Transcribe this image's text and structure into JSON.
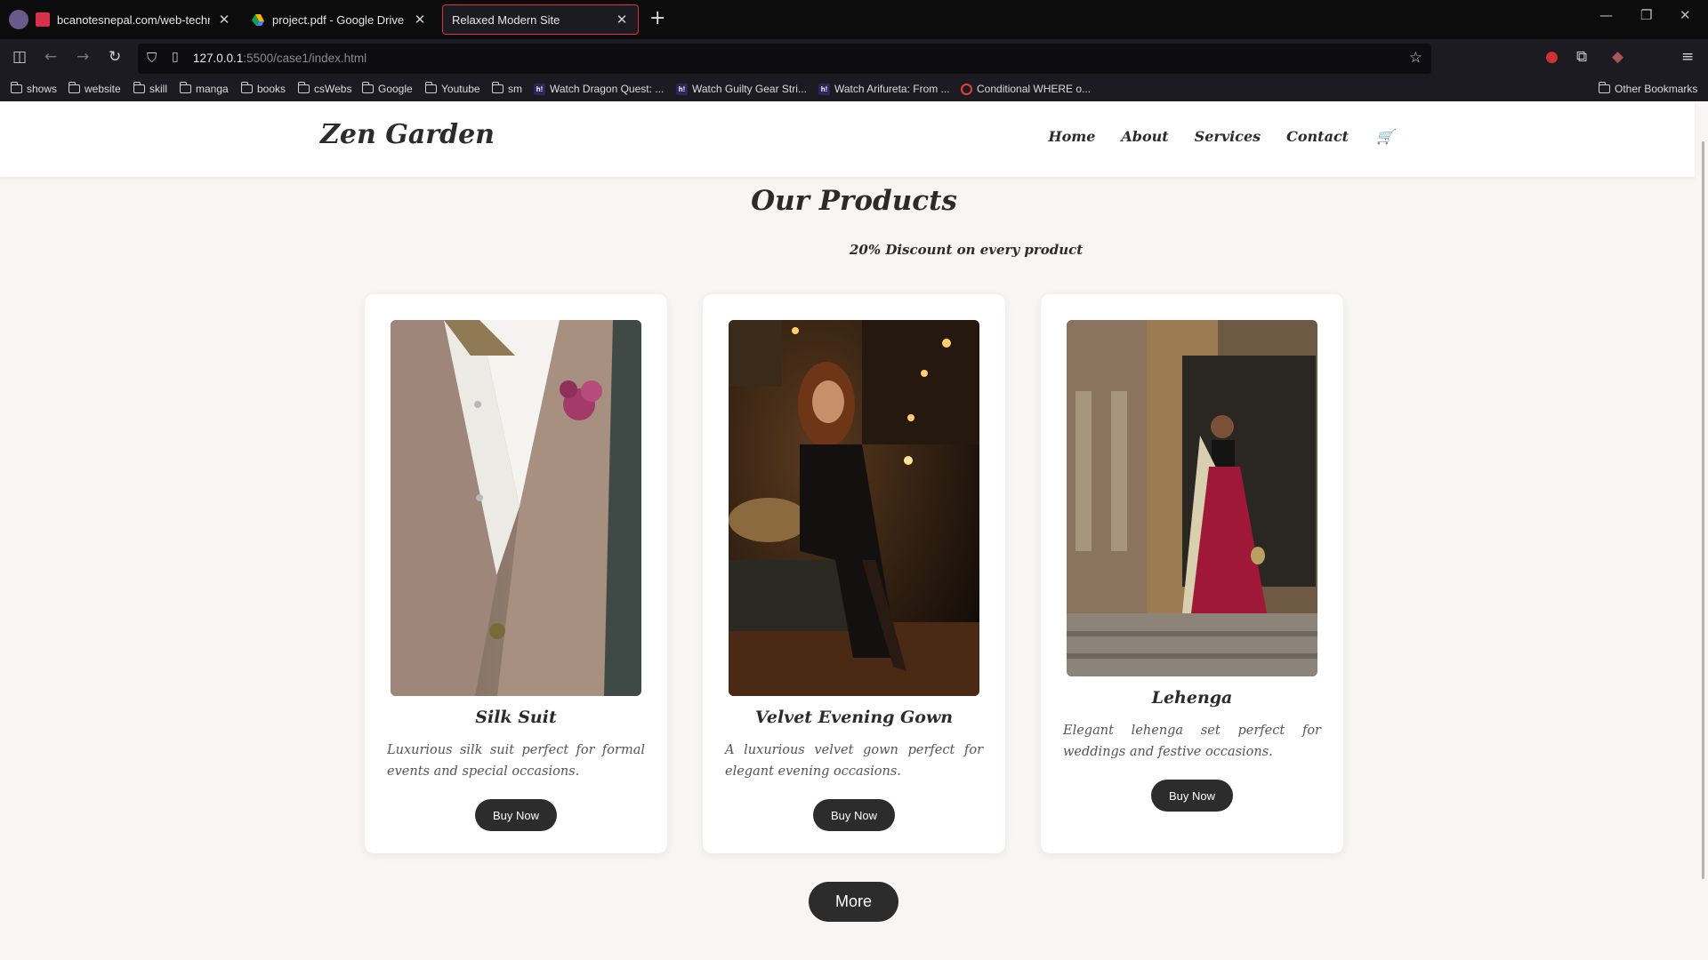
{
  "browser": {
    "tabs": [
      {
        "title": "bcanotesnepal.com/web-techn",
        "favicon_color": "#d8304a"
      },
      {
        "title": "project.pdf - Google Drive",
        "favicon_color": "#f4b400"
      },
      {
        "title": "Relaxed Modern Site",
        "favicon_color": "#1c1b22"
      }
    ],
    "new_tab_icon": "+",
    "url_host": "127.0.0.1",
    "url_path": ":5500/case1/index.html",
    "bookmarks": [
      {
        "label": "shows",
        "icon": "folder-icon"
      },
      {
        "label": "website",
        "icon": "folder-icon"
      },
      {
        "label": "skill",
        "icon": "folder-icon"
      },
      {
        "label": "manga",
        "icon": "folder-icon"
      },
      {
        "label": "books",
        "icon": "folder-icon"
      },
      {
        "label": "csWebs",
        "icon": "folder-icon"
      },
      {
        "label": "Google",
        "icon": "folder-icon"
      },
      {
        "label": "Youtube",
        "icon": "folder-icon"
      },
      {
        "label": "sm",
        "icon": "folder-icon"
      },
      {
        "label": "Watch Dragon Quest: ...",
        "icon": "hianime-icon"
      },
      {
        "label": "Watch Guilty Gear Stri...",
        "icon": "hianime-icon"
      },
      {
        "label": "Watch Arifureta: From ...",
        "icon": "hianime-icon"
      },
      {
        "label": "Conditional WHERE o...",
        "icon": "search-icon"
      }
    ],
    "other_bookmarks": "Other Bookmarks",
    "hianime_glyph": "h!"
  },
  "site": {
    "logo": "Zen Garden",
    "nav": [
      "Home",
      "About",
      "Services",
      "Contact"
    ],
    "cart_glyph": "🛒",
    "section_title": "Our Products",
    "section_subtitle": "20% Discount on every product",
    "products": [
      {
        "name": "Silk Suit",
        "description": "Luxurious silk suit perfect for formal events and special occasions.",
        "button": "Buy Now"
      },
      {
        "name": "Velvet Evening Gown",
        "description": "A luxurious velvet gown perfect for elegant evening occasions.",
        "button": "Buy Now"
      },
      {
        "name": "Lehenga",
        "description": "Elegant lehenga set perfect for weddings and festive occasions.",
        "button": "Buy Now"
      }
    ],
    "more_button": "More"
  },
  "colors": {
    "accent_tab_border": "#d8304a",
    "button_bg": "#2c2c2c",
    "page_bg": "#f7f6f5"
  }
}
